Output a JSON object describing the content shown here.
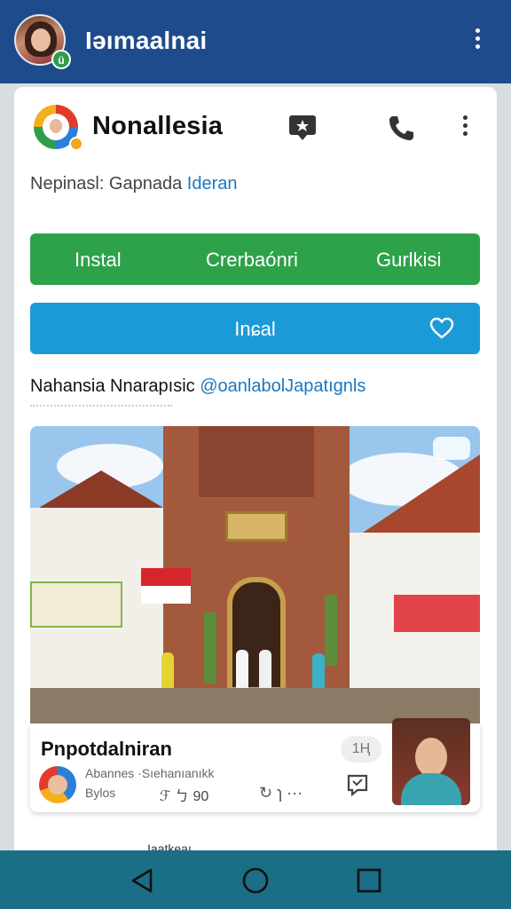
{
  "appbar": {
    "title": "Iəımaalnai",
    "badge": "ü"
  },
  "app": {
    "name": "Nonallesia",
    "subtitle_prefix": "Nepinasl: Gapnada",
    "subtitle_link": "Ideran"
  },
  "green_actions": [
    "Instal",
    "Crerbaónri",
    "Gurlkisi"
  ],
  "primary_button": {
    "label": "Inɕal"
  },
  "caption": {
    "text": "Nahansia Nnarapısic",
    "link": "@oanlabolJapatıgnls"
  },
  "post": {
    "title": "Pnpotdalniran",
    "count": "1Ⱨ",
    "meta_line1": "Abannes ·Sıehanıanıkk",
    "meta_line2": "Bylos",
    "meta_value": "ℱ ㄅ 90",
    "actions": "↻ ɿ ···"
  },
  "card_bottom": {
    "label": "Iaatkeaı"
  },
  "icons": [
    "avatar",
    "menu-icon",
    "app-logo",
    "chat-icon",
    "phone-icon",
    "heart-icon",
    "flag-icon",
    "back-icon",
    "home-icon",
    "recents-icon"
  ],
  "colors": {
    "appbar": "#1e4b8c",
    "green": "#2ea24a",
    "blue": "#1a9bd7",
    "link": "#1a78c2",
    "navbar": "#1a6e86"
  }
}
